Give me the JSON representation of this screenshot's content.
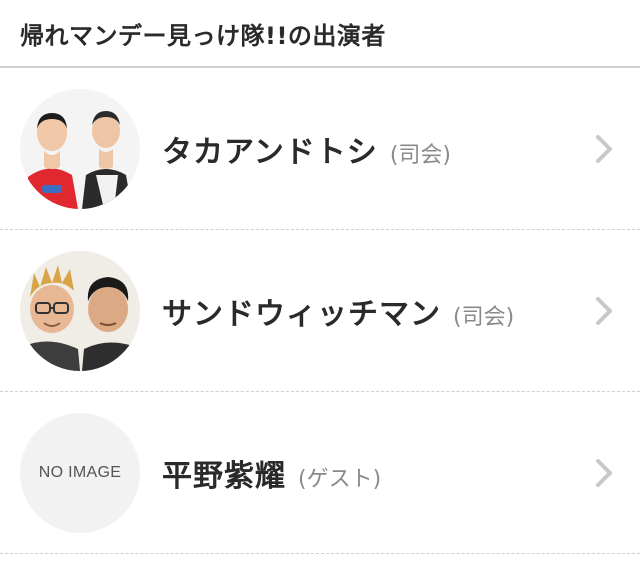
{
  "header": {
    "title": "帰れマンデー見っけ隊!!の出演者"
  },
  "cast": [
    {
      "name": "タカアンドトシ",
      "role": "(司会)",
      "icon": "duo-portrait-photo"
    },
    {
      "name": "サンドウィッチマン",
      "role": "(司会)",
      "icon": "duo-portrait-photo"
    },
    {
      "name": "平野紫耀",
      "role": "(ゲスト)",
      "no_image_text": "NO IMAGE"
    }
  ],
  "colors": {
    "chevron": "#c8c8c8",
    "divider": "#cfcfcf",
    "role_text": "#8a8a8a",
    "no_image_bg": "#f2f2f2"
  },
  "chevron_icon": "chevron-right-icon"
}
